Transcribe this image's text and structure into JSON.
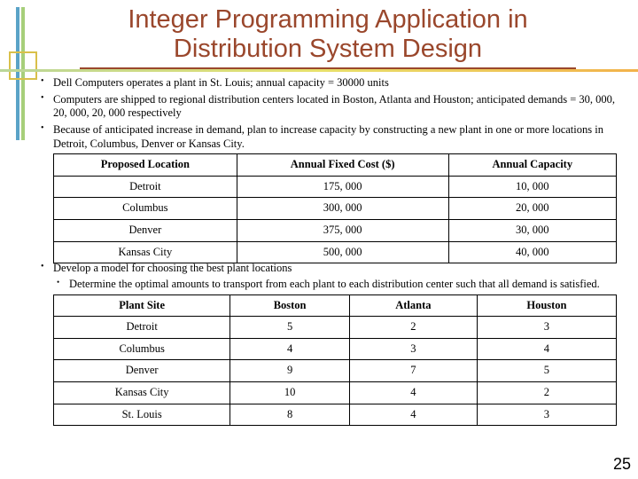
{
  "title": "Integer Programming Application in Distribution System Design",
  "bullets": {
    "b1": "Dell Computers operates a plant in St. Louis; annual capacity = 30000 units",
    "b2": "Computers are shipped to regional distribution centers located in Boston, Atlanta and Houston; anticipated demands = 30, 000, 20, 000, 20, 000 respectively",
    "b3": "Because of anticipated increase in demand, plan to increase capacity by constructing a new plant in one or more locations in Detroit, Columbus, Denver or Kansas City.",
    "b4": "Develop a model for choosing the best plant locations",
    "b4_sub": "Determine the optimal amounts to transport from each plant to each distribution center such that all demand is satisfied."
  },
  "table1": {
    "headers": {
      "c1": "Proposed Location",
      "c2": "Annual Fixed Cost ($)",
      "c3": "Annual Capacity"
    },
    "rows": [
      {
        "c1": "Detroit",
        "c2": "175, 000",
        "c3": "10, 000"
      },
      {
        "c1": "Columbus",
        "c2": "300, 000",
        "c3": "20, 000"
      },
      {
        "c1": "Denver",
        "c2": "375, 000",
        "c3": "30, 000"
      },
      {
        "c1": "Kansas City",
        "c2": "500, 000",
        "c3": "40, 000"
      }
    ]
  },
  "table2": {
    "headers": {
      "c1": "Plant Site",
      "c2": "Boston",
      "c3": "Atlanta",
      "c4": "Houston"
    },
    "rows": [
      {
        "c1": "Detroit",
        "c2": "5",
        "c3": "2",
        "c4": "3"
      },
      {
        "c1": "Columbus",
        "c2": "4",
        "c3": "3",
        "c4": "4"
      },
      {
        "c1": "Denver",
        "c2": "9",
        "c3": "7",
        "c4": "5"
      },
      {
        "c1": "Kansas City",
        "c2": "10",
        "c3": "4",
        "c4": "2"
      },
      {
        "c1": "St. Louis",
        "c2": "8",
        "c3": "4",
        "c4": "3"
      }
    ]
  },
  "page_number": "25"
}
